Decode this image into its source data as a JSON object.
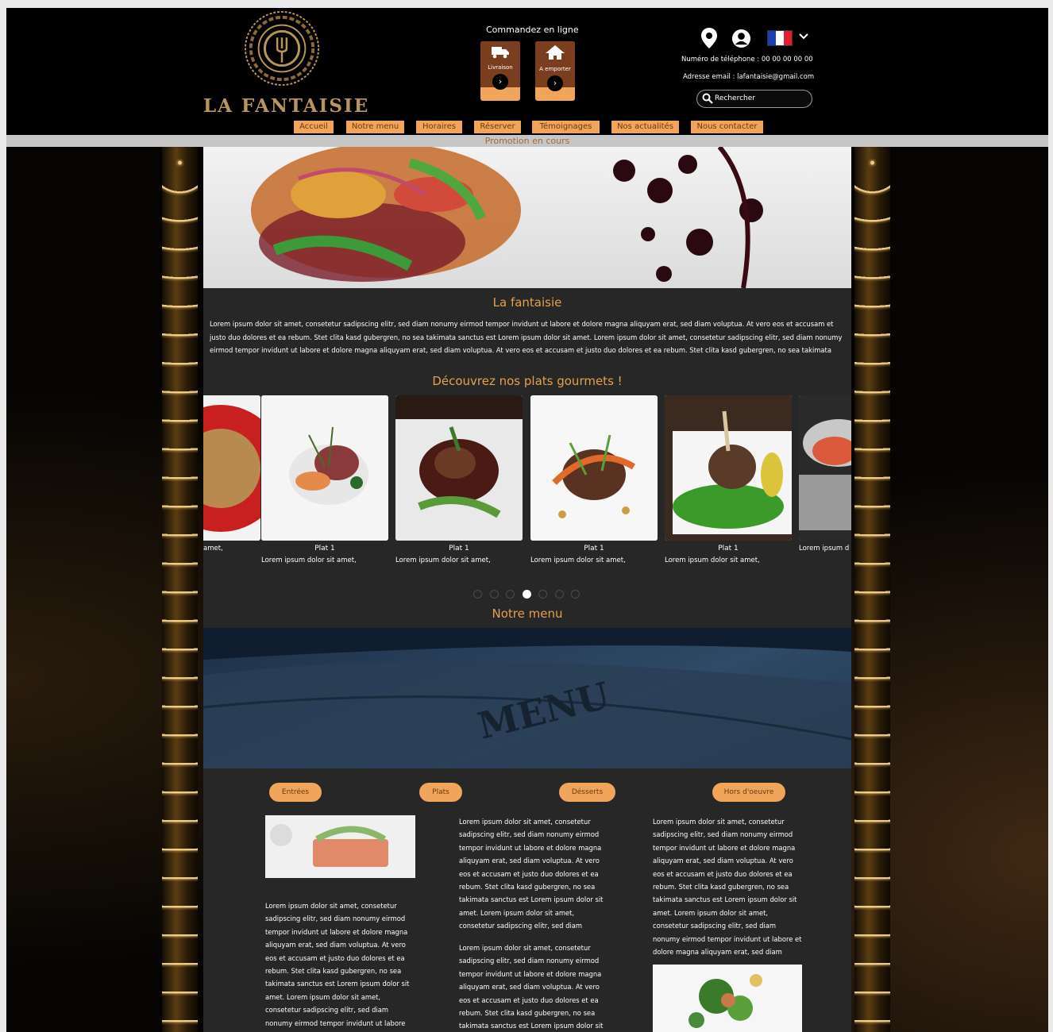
{
  "header": {
    "brand": "LA FANTAISIE",
    "order_title": "Commandez en ligne",
    "order_buttons": [
      {
        "label": "Livraison",
        "icon": "truck-icon"
      },
      {
        "label": "A emporter",
        "icon": "house-icon"
      }
    ],
    "phone": "Numéro de téléphone : 00 00 00 00 00",
    "email": "Adresse email : lafantaisie@gmail.com",
    "search_placeholder": "Rechercher",
    "language_flag": "fr",
    "colors": {
      "accent": "#f0a55a",
      "brand_gold": "#b8965a",
      "dark_button": "#7a3d1d"
    }
  },
  "nav": {
    "items": [
      "Accueil",
      "Notre menu",
      "Horaires",
      "Réserver",
      "Témoignages",
      "Nos actualités",
      "Nous contacter"
    ]
  },
  "promo": "Promotion en cours",
  "intro": {
    "title": "La fantaisie",
    "text": "Lorem ipsum dolor sit amet, consetetur sadipscing elitr, sed diam nonumy eirmod tempor invidunt ut labore et dolore magna aliquyam erat, sed diam voluptua. At vero eos et accusam et justo duo dolores et ea rebum. Stet clita kasd gubergren, no sea takimata sanctus est Lorem ipsum dolor sit amet. Lorem ipsum dolor sit amet, consetetur sadipscing elitr, sed diam nonumy eirmod tempor invidunt ut labore et dolore magna aliquyam erat, sed diam voluptua. At vero eos et accusam et justo duo dolores et ea rebum. Stet clita kasd gubergren, no sea takimata"
  },
  "gourmet": {
    "title": "Découvrez nos plats gourmets !",
    "cards": [
      {
        "name": "",
        "desc": "amet,"
      },
      {
        "name": "Plat 1",
        "desc": "Lorem ipsum dolor sit amet,"
      },
      {
        "name": "Plat 1",
        "desc": "Lorem ipsum dolor sit amet,"
      },
      {
        "name": "Plat 1",
        "desc": "Lorem ipsum dolor sit amet,"
      },
      {
        "name": "Plat 1",
        "desc": "Lorem ipsum dolor sit amet,"
      },
      {
        "name": "",
        "desc": "Lorem ipsum d"
      }
    ],
    "dots_total": 7,
    "active_dot": 4
  },
  "menu": {
    "title": "Notre menu",
    "image_text": "MENU",
    "categories": [
      "Entrées",
      "Plats",
      "Désserts",
      "Hors d'oeuvre"
    ],
    "col1_text": "Lorem ipsum dolor sit amet, consetetur sadipscing elitr, sed diam nonumy eirmod tempor invidunt ut labore et dolore magna aliquyam erat, sed diam voluptua. At vero eos et accusam et justo duo dolores et ea rebum. Stet clita kasd gubergren, no sea takimata sanctus est Lorem ipsum dolor sit amet. Lorem ipsum dolor sit amet, consetetur sadipscing elitr, sed diam nonumy eirmod tempor invidunt ut labore et dolore magna aliquyam erat, sed diam",
    "col2_text_1": "Lorem ipsum dolor sit amet, consetetur sadipscing elitr, sed diam nonumy eirmod tempor invidunt ut labore et dolore magna aliquyam erat, sed diam voluptua. At vero eos et accusam et justo duo dolores et ea rebum. Stet clita kasd gubergren, no sea takimata sanctus est Lorem ipsum dolor sit amet. Lorem ipsum dolor sit amet, consetetur sadipscing elitr, sed diam",
    "col2_text_2": "Lorem ipsum dolor sit amet, consetetur sadipscing elitr, sed diam nonumy eirmod tempor invidunt ut labore et dolore magna aliquyam erat, sed diam voluptua. At vero eos et accusam et justo duo dolores et ea rebum. Stet clita kasd gubergren, no sea takimata sanctus est Lorem ipsum dolor sit",
    "col3_text": "Lorem ipsum dolor sit amet, consetetur sadipscing elitr, sed diam nonumy eirmod tempor invidunt ut labore et dolore magna aliquyam erat, sed diam voluptua. At vero eos et accusam et justo duo dolores et ea rebum. Stet clita kasd gubergren, no sea takimata sanctus est Lorem ipsum dolor sit amet. Lorem ipsum dolor sit amet, consetetur sadipscing elitr, sed diam nonumy eirmod tempor invidunt ut labore et dolore magna aliquyam erat, sed diam"
  }
}
